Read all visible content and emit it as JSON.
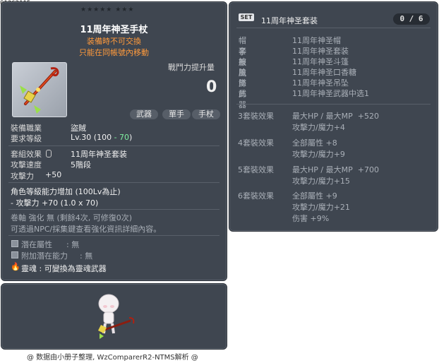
{
  "item_id": "01362115",
  "left_panel": {
    "stars": "★★★★★  ★★★",
    "title": "11周年神圣手杖",
    "notice_1": "装備時不可交換",
    "notice_2": "只能在同帳號內移動",
    "power_label": "戰鬥力提升量",
    "power_value": "0",
    "tags": [
      "武器",
      "單手",
      "手杖"
    ],
    "job_label": "裝備職業",
    "job_value": "盜賊",
    "level_label": "要求等級",
    "level_value_prefix": "Lv.30 (100 ",
    "level_value_bonus": "- 70",
    "level_value_suffix": ")",
    "set_effect_label": "套組效果",
    "set_effect_value": "11周年神圣套装",
    "speed_label": "攻擊速度",
    "speed_value": "5階段",
    "attack_label": "攻擊力",
    "attack_value": "+50",
    "level_growth_line1": "角色等級能力增加 (100Lv為止)",
    "level_growth_line2": "- 攻擊力 +70 (1.0 x 70)",
    "scroll_line": "卷軸 強化 無 (剩餘4次, 可修復0次)",
    "npc_line": "可透過NPC/採集鍵查看強化資訊詳細內容。",
    "potential_label": "潛在屬性",
    "potential_value": ": 無",
    "add_potential_label": "附加潛在能力",
    "add_potential_value": ": 無",
    "soul_line": "靈魂 : 可變換為靈魂武器"
  },
  "right_panel": {
    "set_badge": "SET",
    "set_name": "11周年神圣套装",
    "set_count": "0 / 6",
    "pieces": [
      {
        "slot": "帽子",
        "name": "11周年神圣帽"
      },
      {
        "slot": "套服",
        "name": "11周年神圣套装"
      },
      {
        "slot": "披風",
        "name": "11周年神圣斗篷"
      },
      {
        "slot": "臉飾",
        "name": "11周年神圣口香糖"
      },
      {
        "slot": "墜飾",
        "name": "11周年神圣吊坠"
      },
      {
        "slot": "武器",
        "name": "11周年神圣武器中选1"
      }
    ],
    "effects": [
      {
        "label": "3套裝效果",
        "lines": [
          [
            "最大HP / 最大MP",
            "+520"
          ],
          [
            "攻擊力/魔力",
            "+4"
          ]
        ]
      },
      {
        "label": "4套裝效果",
        "lines": [
          [
            "全部屬性",
            "+8"
          ],
          [
            "攻擊力/魔力",
            "+9"
          ]
        ]
      },
      {
        "label": "5套裝效果",
        "lines": [
          [
            "最大HP / 最大MP",
            "+700"
          ],
          [
            "攻擊力/魔力",
            "+15"
          ]
        ]
      },
      {
        "label": "6套裝效果",
        "lines": [
          [
            "全部屬性",
            "+9"
          ],
          [
            "攻擊力/魔力",
            "+21"
          ],
          [
            "伤害",
            "+9%"
          ]
        ]
      }
    ]
  },
  "credit": "@ 数据由小册子整理, WzComparerR2-NTMS解析 @",
  "colors": {
    "panel": "#3f4650",
    "notice": "#ff9a3c",
    "bonus": "#7ff0a0"
  }
}
